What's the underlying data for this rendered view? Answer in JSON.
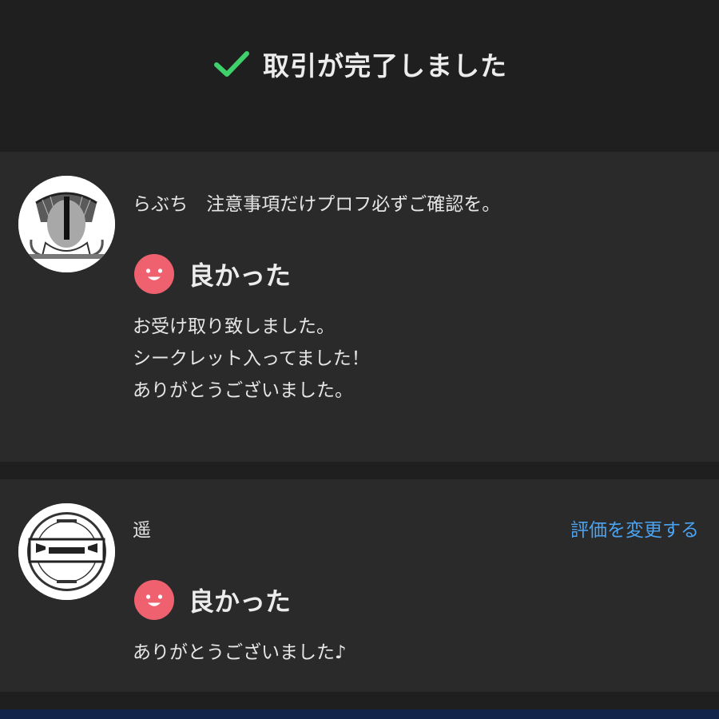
{
  "header": {
    "title": "取引が完了しました",
    "check_color": "#3fcf6b"
  },
  "reviews": [
    {
      "username": "らぶち　注意事項だけプロフ必ずご確認を。",
      "rating": "良かった",
      "comment_lines": [
        "お受け取り致しました。",
        "シークレット入ってました！",
        "ありがとうございました。"
      ]
    },
    {
      "username": "遥",
      "rating": "良かった",
      "comment_lines": [
        "ありがとうございました♪"
      ],
      "change_link": "評価を変更する"
    }
  ],
  "colors": {
    "smile_face": "#f06170",
    "link": "#4aa3f0",
    "bottom_bar": "#12244a"
  }
}
